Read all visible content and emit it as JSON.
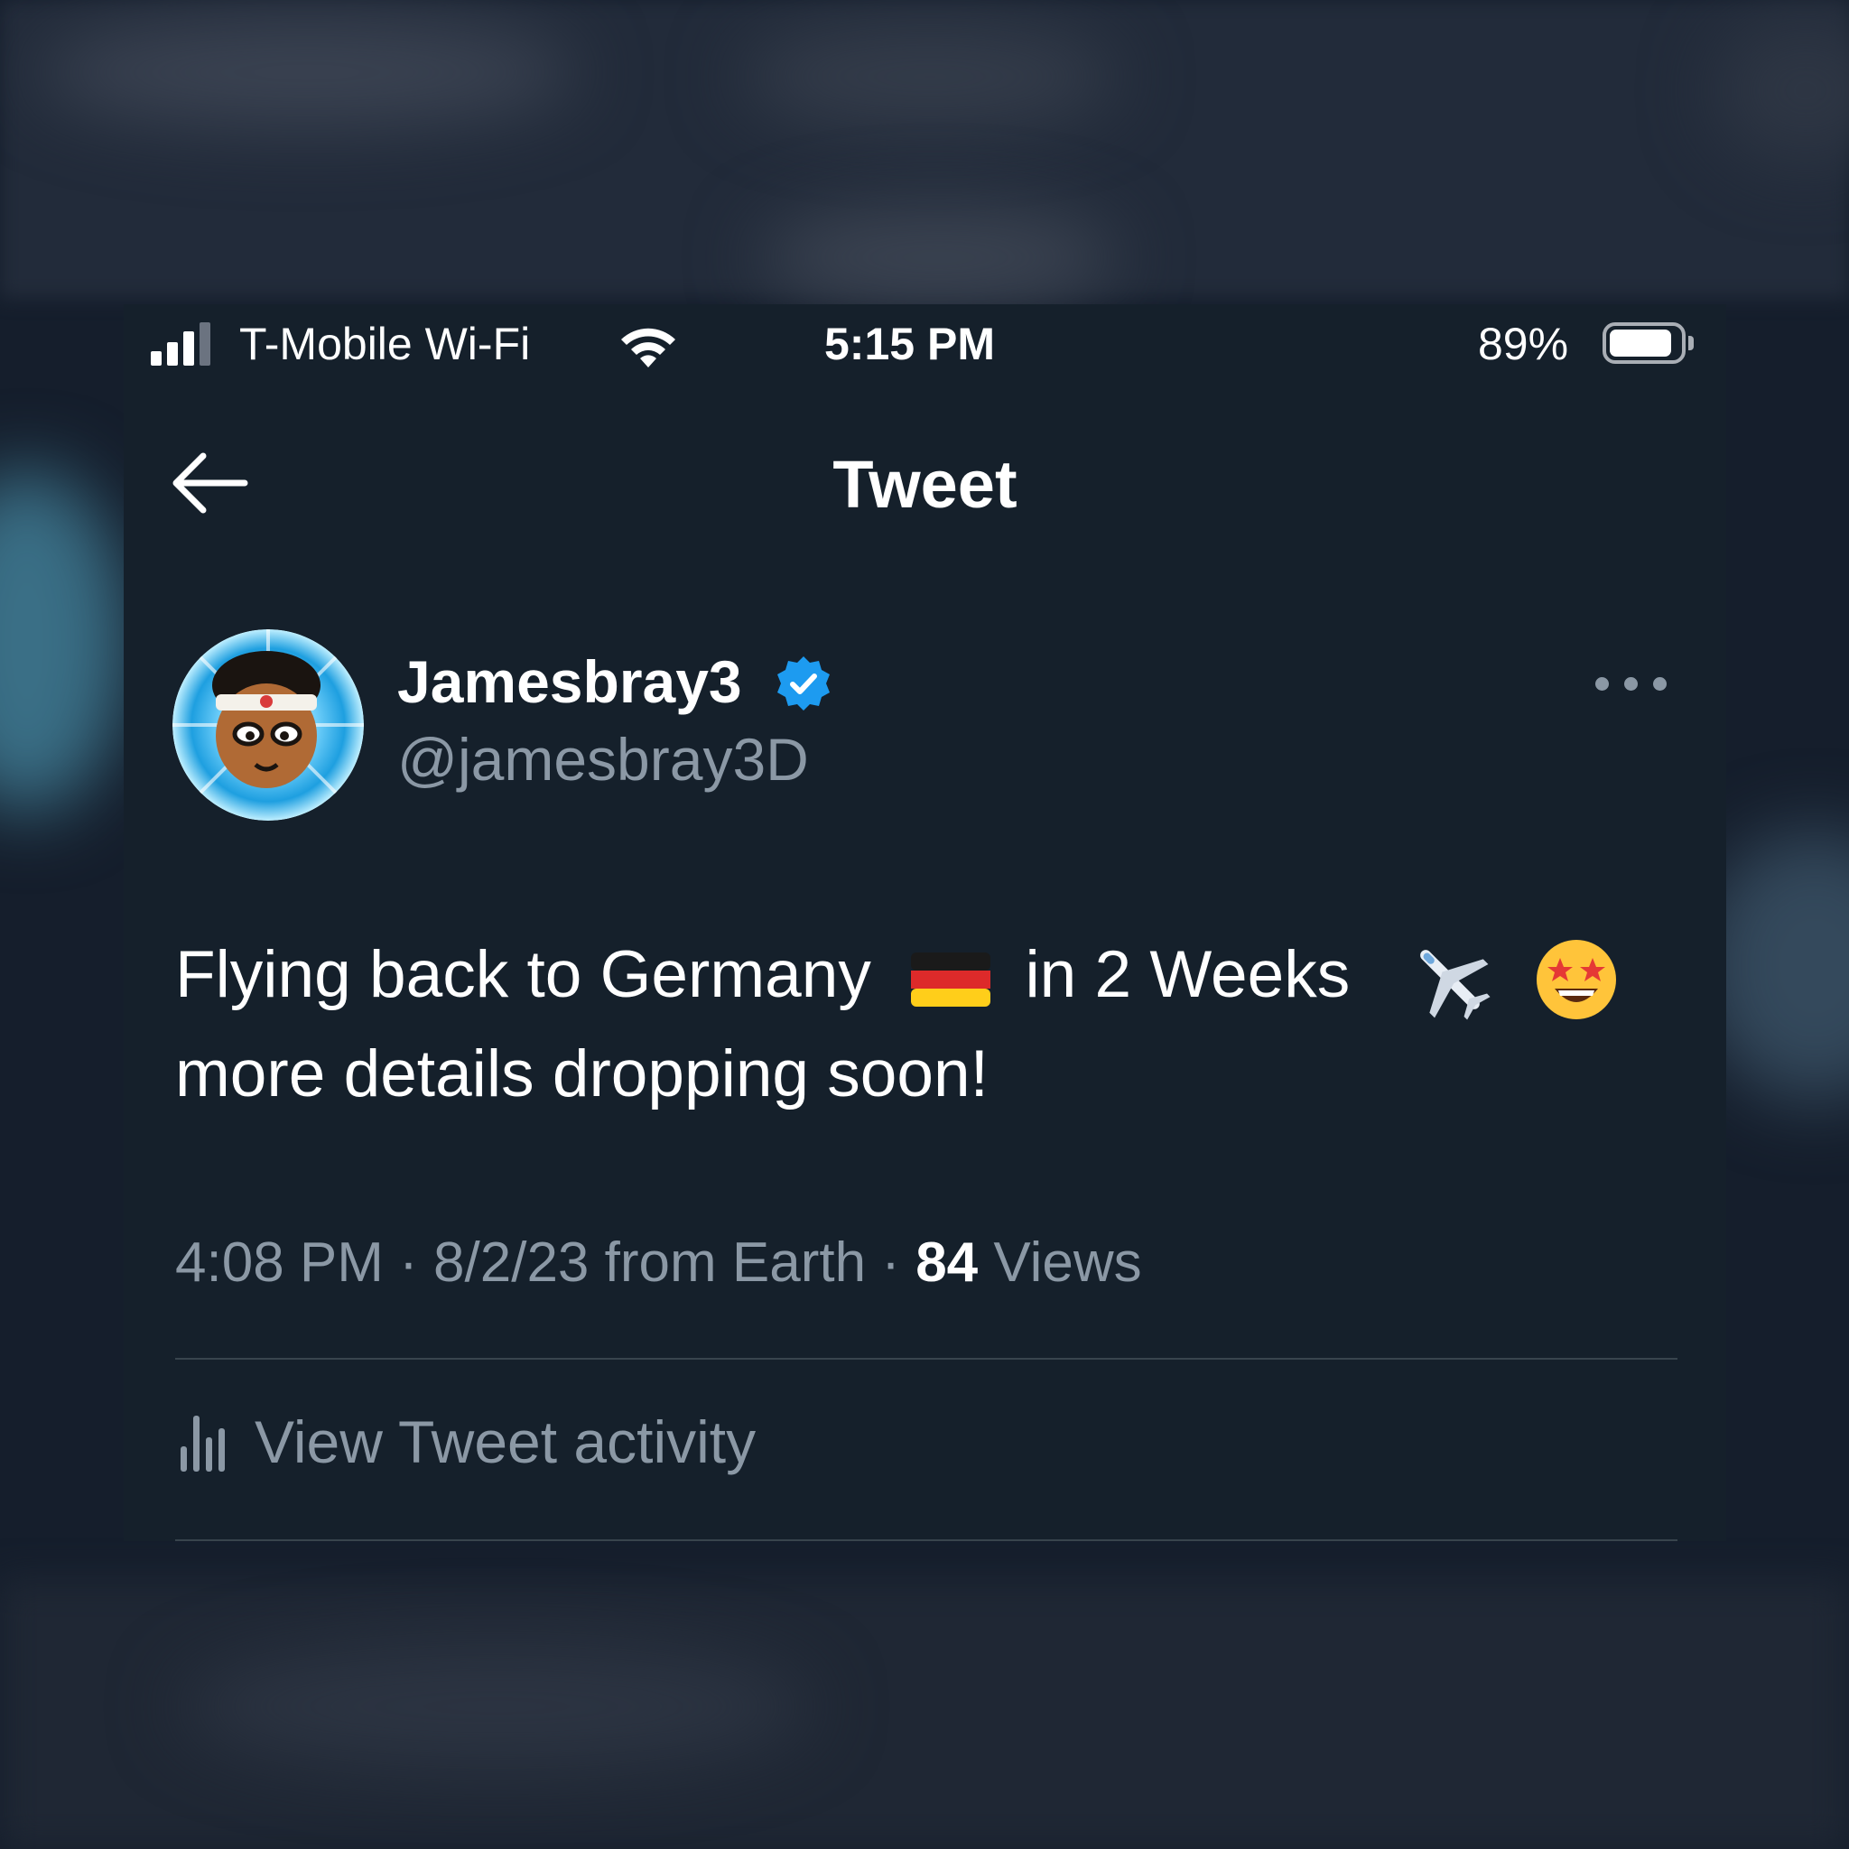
{
  "status_bar": {
    "carrier": "T-Mobile Wi-Fi",
    "time": "5:15 PM",
    "battery_percent": "89%",
    "battery_level": 0.89,
    "signal_bars_filled": 3,
    "signal_bars_total": 4
  },
  "header": {
    "title": "Tweet",
    "back_icon": "arrow-left-icon"
  },
  "tweet": {
    "display_name": "Jamesbray3",
    "verified": true,
    "handle": "@jamesbray3D",
    "text_line1_a": "Flying back to Germany",
    "text_line1_b": "in 2 Weeks",
    "text_line2": "more details dropping soon!",
    "emojis": [
      "germany-flag",
      "airplane",
      "star-struck-face"
    ],
    "time": "4:08 PM",
    "separator": "·",
    "date_source": "8/2/23 from Earth",
    "views_count": "84",
    "views_label": "Views"
  },
  "activity": {
    "label": "View Tweet activity",
    "icon": "bar-chart-icon"
  },
  "colors": {
    "background": "#15202b",
    "text_primary": "#ffffff",
    "text_secondary": "#8b98a5",
    "divider": "#38444d",
    "verified_blue": "#1d9bf0"
  }
}
